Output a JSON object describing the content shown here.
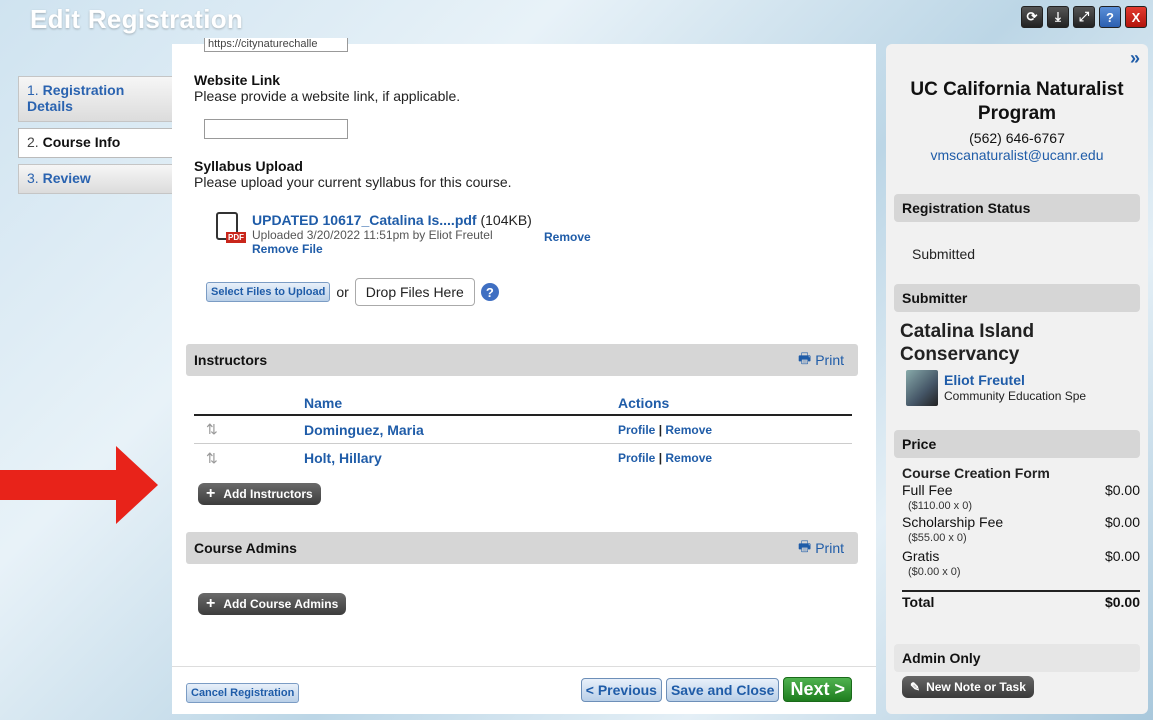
{
  "window": {
    "title": "Edit Registration"
  },
  "steps": [
    {
      "num": "1.",
      "label": "Registration Details"
    },
    {
      "num": "2.",
      "label": "Course Info"
    },
    {
      "num": "3.",
      "label": "Review"
    }
  ],
  "top_field_value": "https://citynaturechalle",
  "website": {
    "label": "Website Link",
    "help": "Please provide a website link, if applicable.",
    "value": ""
  },
  "syllabus": {
    "label": "Syllabus Upload",
    "help": "Please upload your current syllabus for this course.",
    "file_name": "UPDATED 10617_Catalina Is....pdf",
    "file_size": "(104KB)",
    "uploaded": "Uploaded 3/20/2022 11:51pm by Eliot Freutel",
    "remove_file": "Remove File",
    "remove": "Remove",
    "pdf_tag": "PDF",
    "select_files": "Select Files to Upload",
    "or": "or",
    "drop_files": "Drop Files Here"
  },
  "instructors": {
    "label": "Instructors",
    "print": "Print",
    "col_name": "Name",
    "col_actions": "Actions",
    "rows": [
      {
        "name": "Dominguez, Maria",
        "profile": "Profile",
        "sep": "|",
        "remove": "Remove"
      },
      {
        "name": "Holt, Hillary",
        "profile": "Profile",
        "sep": "|",
        "remove": "Remove"
      }
    ],
    "add": "Add Instructors"
  },
  "course_admins": {
    "label": "Course Admins",
    "print": "Print",
    "add": "Add Course Admins"
  },
  "footer": {
    "cancel": "Cancel Registration",
    "previous": "< Previous",
    "save_close": "Save and Close",
    "next": "Next >"
  },
  "sidebar": {
    "collapse": "»",
    "org": "UC California Naturalist Program",
    "phone": "(562) 646-6767",
    "email": "vmscanaturalist@ucanr.edu",
    "status_hdr": "Registration Status",
    "status": "Submitted",
    "submitter_hdr": "Submitter",
    "submitter_org": "Catalina Island Conservancy",
    "submitter_name": "Eliot Freutel",
    "submitter_role": "Community Education Spe",
    "price_hdr": "Price",
    "price_form": "Course Creation Form",
    "fees": [
      {
        "label": "Full Fee",
        "amount": "$0.00",
        "detail": "($110.00 x 0)"
      },
      {
        "label": "Scholarship Fee",
        "amount": "$0.00",
        "detail": "($55.00 x 0)"
      },
      {
        "label": "Gratis",
        "amount": "$0.00",
        "detail": "($0.00 x 0)"
      }
    ],
    "total_label": "Total",
    "total": "$0.00",
    "admin_hdr": "Admin Only",
    "new_note": "New Note or Task"
  },
  "colors": {
    "arrow": "#e8231a",
    "link": "#1f5ca8",
    "next": "#2e8f2e"
  }
}
